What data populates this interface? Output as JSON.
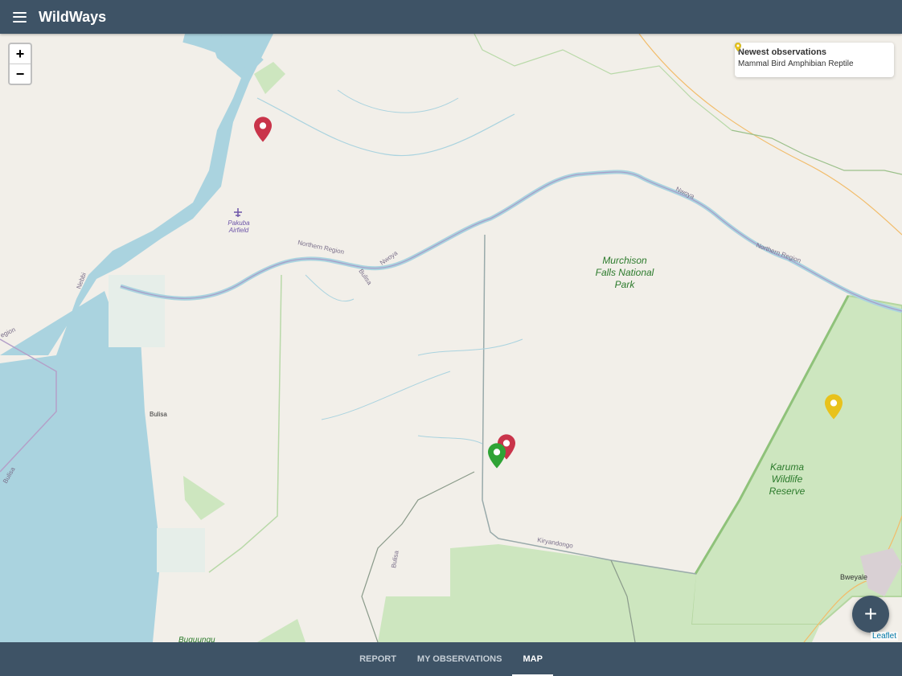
{
  "app": {
    "title": "WildWays"
  },
  "map": {
    "zoom_in": "+",
    "zoom_out": "−",
    "attribution": "Leaflet",
    "labels": {
      "pakuba": "Pakuba",
      "airfield": "Airfield",
      "northern_region_1": "Northern Region",
      "northern_region_2": "Northern Region",
      "nwoya_1": "Nwoya",
      "nwoya_2": "Nwoya",
      "bulisa_1": "Bulisa",
      "bulisa_2": "Bulisa",
      "bulisa_3": "Bulisa",
      "bulisa_4": "Bulisa",
      "region": "egion",
      "nebbi": "Nebbi",
      "park_line1": "Murchison",
      "park_line2": "Falls National",
      "park_line3": "Park",
      "reserve_line1": "Karuma",
      "reserve_line2": "Wildlife",
      "reserve_line3": "Reserve",
      "kiryandongo": "Kiryandongo",
      "bweyale": "Bweyale",
      "buguungu": "Buguungu"
    }
  },
  "legend": {
    "title": "Newest observations",
    "items": [
      {
        "label": "Mammal",
        "color": "#c9344a",
        "icon": "map-pin-icon"
      },
      {
        "label": "Bird",
        "color": "#2fa335",
        "icon": "map-pin-icon"
      },
      {
        "label": "Amphibian",
        "color": "#3c8fd6",
        "icon": "map-pin-icon"
      },
      {
        "label": "Reptile",
        "color": "#e8c21c",
        "icon": "map-pin-icon"
      }
    ]
  },
  "markers": [
    {
      "type": "Mammal",
      "color": "#c9344a"
    },
    {
      "type": "Mammal",
      "color": "#c9344a"
    },
    {
      "type": "Bird",
      "color": "#2fa335"
    },
    {
      "type": "Reptile",
      "color": "#e8c21c"
    }
  ],
  "fab": {
    "label": "+",
    "icon": "plus-icon"
  },
  "nav": {
    "tabs": [
      "REPORT",
      "MY OBSERVATIONS",
      "MAP"
    ],
    "active": "MAP"
  },
  "colors": {
    "bar": "#3e5366",
    "water": "#aad3df",
    "park": "#c8e0b8",
    "land": "#f2efe9"
  }
}
